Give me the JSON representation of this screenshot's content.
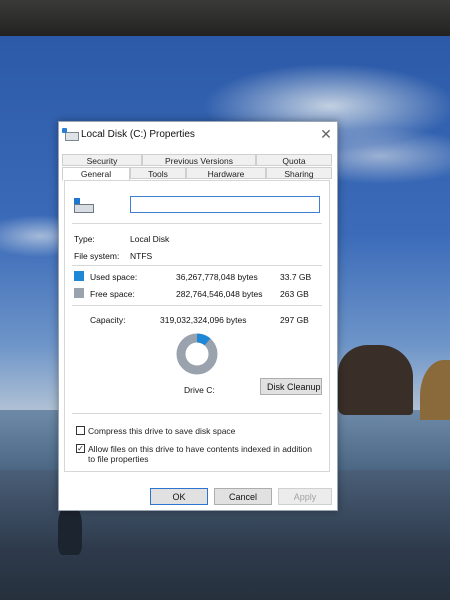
{
  "window": {
    "title": "Local Disk (C:) Properties",
    "close_glyph": "✕"
  },
  "tabs": {
    "row_back": [
      "Security",
      "Previous Versions",
      "Quota"
    ],
    "row_front": [
      "General",
      "Tools",
      "Hardware",
      "Sharing"
    ],
    "active": "General"
  },
  "general": {
    "name_value": "",
    "type_label": "Type:",
    "type_value": "Local Disk",
    "fs_label": "File system:",
    "fs_value": "NTFS",
    "used": {
      "label": "Used space:",
      "bytes": "36,267,778,048 bytes",
      "size": "33.7 GB",
      "color": "#1e88d6"
    },
    "free": {
      "label": "Free space:",
      "bytes": "282,764,546,048 bytes",
      "size": "263 GB",
      "color": "#9aa3ad"
    },
    "capacity": {
      "label": "Capacity:",
      "bytes": "319,032,324,096 bytes",
      "size": "297 GB"
    },
    "used_fraction": 0.114,
    "drive_label": "Drive C:",
    "cleanup_label": "Disk Cleanup",
    "compress_label": "Compress this drive to save disk space",
    "compress_checked": false,
    "index_label": "Allow files on this drive to have contents indexed in addition to file properties",
    "index_checked": true
  },
  "buttons": {
    "ok": "OK",
    "cancel": "Cancel",
    "apply": "Apply"
  }
}
